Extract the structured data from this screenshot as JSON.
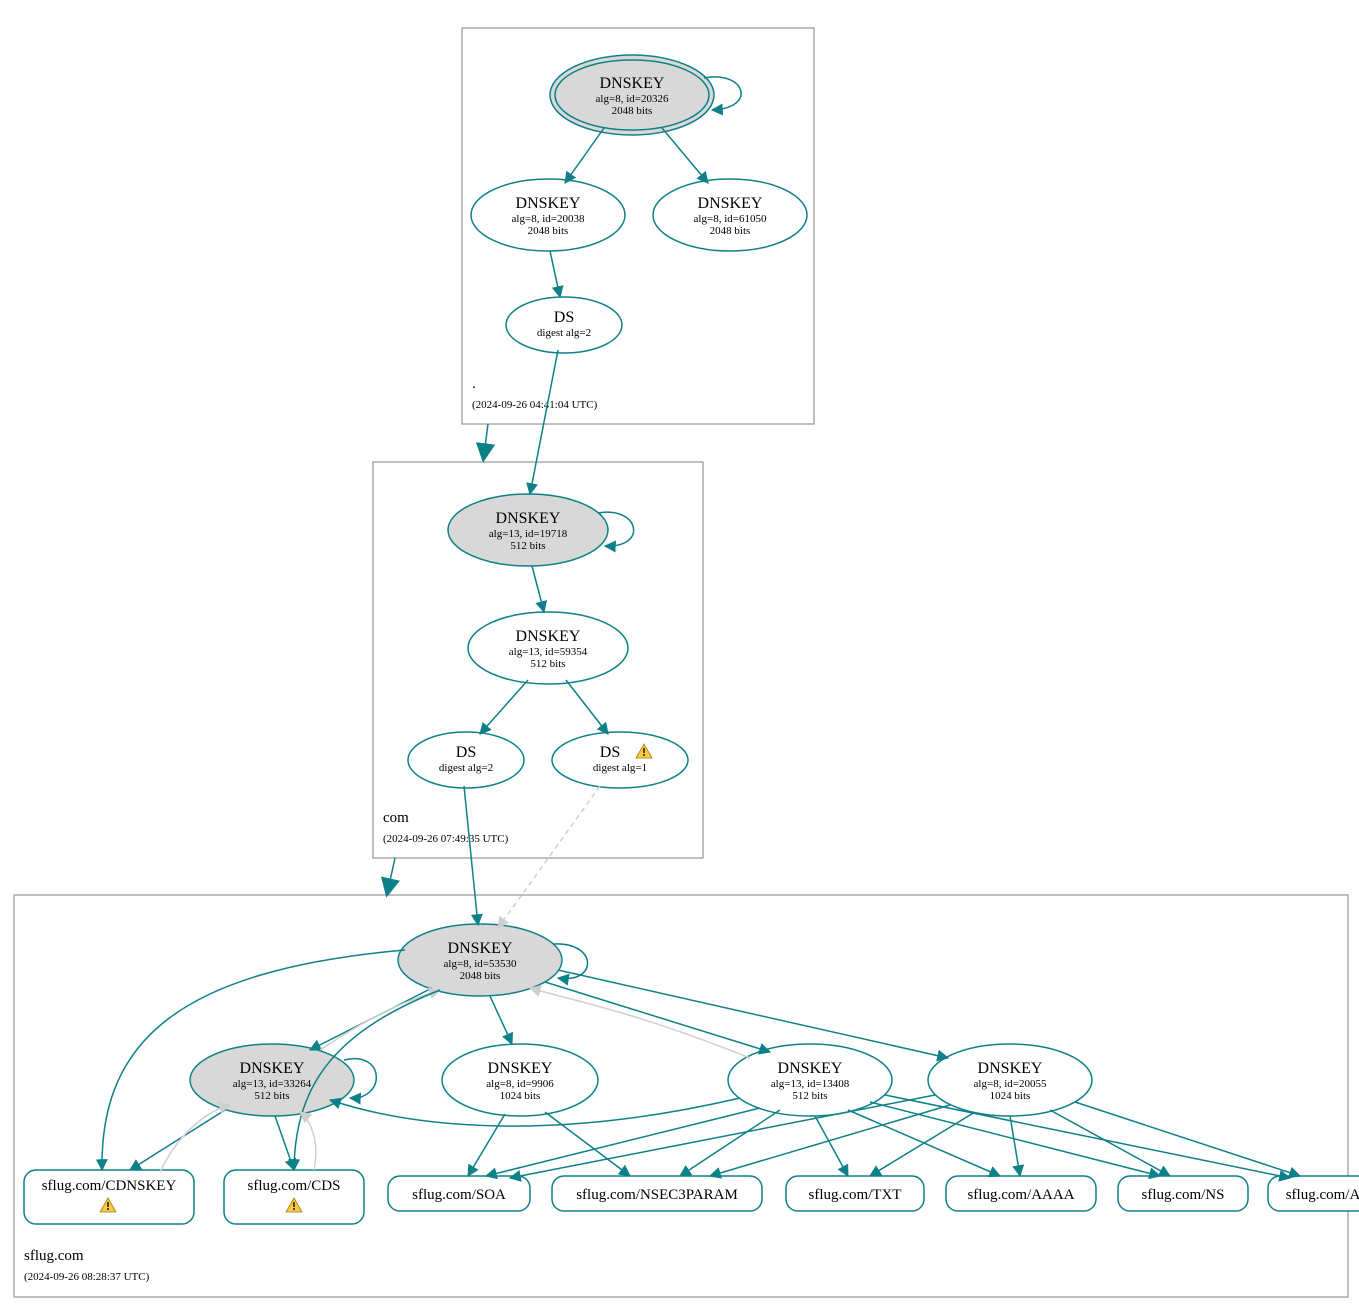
{
  "colors": {
    "teal": "#0e8088",
    "grayFill": "#d8d8d8",
    "lightEdge": "#cfcfcf",
    "boxStroke": "#808080"
  },
  "zones": {
    "root": {
      "label": ".",
      "timestamp": "(2024-09-26 04:41:04 UTC)"
    },
    "com": {
      "label": "com",
      "timestamp": "(2024-09-26 07:49:35 UTC)"
    },
    "sflug": {
      "label": "sflug.com",
      "timestamp": "(2024-09-26 08:28:37 UTC)"
    }
  },
  "nodes": {
    "rootKSK": {
      "title": "DNSKEY",
      "line2": "alg=8, id=20326",
      "line3": "2048 bits"
    },
    "rootZSK1": {
      "title": "DNSKEY",
      "line2": "alg=8, id=20038",
      "line3": "2048 bits"
    },
    "rootZSK2": {
      "title": "DNSKEY",
      "line2": "alg=8, id=61050",
      "line3": "2048 bits"
    },
    "rootDS": {
      "title": "DS",
      "line2": "digest alg=2"
    },
    "comKSK": {
      "title": "DNSKEY",
      "line2": "alg=13, id=19718",
      "line3": "512 bits"
    },
    "comZSK": {
      "title": "DNSKEY",
      "line2": "alg=13, id=59354",
      "line3": "512 bits"
    },
    "comDS1": {
      "title": "DS",
      "line2": "digest alg=2"
    },
    "comDS2": {
      "title": "DS",
      "line2": "digest alg=1"
    },
    "sflugKSK": {
      "title": "DNSKEY",
      "line2": "alg=8, id=53530",
      "line3": "2048 bits"
    },
    "sflugK2": {
      "title": "DNSKEY",
      "line2": "alg=13, id=33264",
      "line3": "512 bits"
    },
    "sflugK3": {
      "title": "DNSKEY",
      "line2": "alg=8, id=9906",
      "line3": "1024 bits"
    },
    "sflugK4": {
      "title": "DNSKEY",
      "line2": "alg=13, id=13408",
      "line3": "512 bits"
    },
    "sflugK5": {
      "title": "DNSKEY",
      "line2": "alg=8, id=20055",
      "line3": "1024 bits"
    },
    "leafCDNSKEY": {
      "label": "sflug.com/CDNSKEY"
    },
    "leafCDS": {
      "label": "sflug.com/CDS"
    },
    "leafSOA": {
      "label": "sflug.com/SOA"
    },
    "leafNSEC3": {
      "label": "sflug.com/NSEC3PARAM"
    },
    "leafTXT": {
      "label": "sflug.com/TXT"
    },
    "leafAAAA": {
      "label": "sflug.com/AAAA"
    },
    "leafNS": {
      "label": "sflug.com/NS"
    },
    "leafA": {
      "label": "sflug.com/A"
    }
  }
}
